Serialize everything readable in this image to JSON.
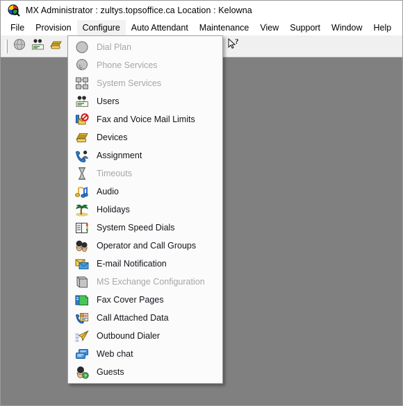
{
  "window": {
    "app_icon": "mx-globe-icon",
    "title": "MX Administrator : zultys.topsoffice.ca   Location : Kelowna"
  },
  "menubar": {
    "items": [
      {
        "label": "File",
        "name": "menu-file",
        "open": false
      },
      {
        "label": "Provision",
        "name": "menu-provision",
        "open": false
      },
      {
        "label": "Configure",
        "name": "menu-configure",
        "open": true
      },
      {
        "label": "Auto Attendant",
        "name": "menu-auto-attendant",
        "open": false
      },
      {
        "label": "Maintenance",
        "name": "menu-maintenance",
        "open": false
      },
      {
        "label": "View",
        "name": "menu-view",
        "open": false
      },
      {
        "label": "Support",
        "name": "menu-support",
        "open": false
      },
      {
        "label": "Window",
        "name": "menu-window",
        "open": false
      },
      {
        "label": "Help",
        "name": "menu-help",
        "open": false
      }
    ]
  },
  "toolbar": {
    "buttons": [
      {
        "name": "globe-icon",
        "glyph": "globe"
      },
      {
        "name": "users-icon",
        "glyph": "users"
      },
      {
        "name": "devices-phone-icon",
        "glyph": "phone-gold"
      },
      {
        "name": "dial-plan-icon",
        "glyph": "dialplan"
      },
      {
        "name": "assignment-icon",
        "glyph": "assignment"
      },
      {
        "name": "call-attached-data-icon",
        "glyph": "calldata"
      },
      {
        "name": "auto-attendant-icon",
        "glyph": "attendant"
      },
      {
        "name": "reports-icon",
        "glyph": "reports"
      },
      {
        "name": "books-icon",
        "glyph": "books"
      },
      {
        "name": "link-icon",
        "glyph": "link"
      },
      {
        "name": "tips-icon",
        "glyph": "bulb"
      },
      {
        "name": "context-help-icon",
        "glyph": "help-arrow"
      }
    ]
  },
  "dropdown": {
    "owner": "Configure",
    "items": [
      {
        "label": "Dial Plan",
        "name": "dial-plan",
        "icon": "dial-plan-icon",
        "disabled": true
      },
      {
        "label": "Phone Services",
        "name": "phone-services",
        "icon": "phone-services-icon",
        "disabled": true
      },
      {
        "label": "System Services",
        "name": "system-services",
        "icon": "system-services-icon",
        "disabled": true
      },
      {
        "label": "Users",
        "name": "users",
        "icon": "users-icon",
        "disabled": false
      },
      {
        "label": "Fax and Voice Mail Limits",
        "name": "fax-voicemail-limits",
        "icon": "fax-limits-icon",
        "disabled": false
      },
      {
        "label": "Devices",
        "name": "devices",
        "icon": "devices-icon",
        "disabled": false
      },
      {
        "label": "Assignment",
        "name": "assignment",
        "icon": "assignment-icon",
        "disabled": false
      },
      {
        "label": "Timeouts",
        "name": "timeouts",
        "icon": "timeouts-icon",
        "disabled": true
      },
      {
        "label": "Audio",
        "name": "audio",
        "icon": "audio-icon",
        "disabled": false
      },
      {
        "label": "Holidays",
        "name": "holidays",
        "icon": "holidays-icon",
        "disabled": false
      },
      {
        "label": "System Speed Dials",
        "name": "system-speed-dials",
        "icon": "speed-dials-icon",
        "disabled": false
      },
      {
        "label": "Operator and Call Groups",
        "name": "operator-call-groups",
        "icon": "operator-groups-icon",
        "disabled": false
      },
      {
        "label": "E-mail Notification",
        "name": "email-notification",
        "icon": "email-icon",
        "disabled": false
      },
      {
        "label": "MS Exchange Configuration",
        "name": "ms-exchange-configuration",
        "icon": "exchange-icon",
        "disabled": true
      },
      {
        "label": "Fax Cover Pages",
        "name": "fax-cover-pages",
        "icon": "fax-cover-icon",
        "disabled": false
      },
      {
        "label": "Call Attached Data",
        "name": "call-attached-data",
        "icon": "call-data-icon",
        "disabled": false
      },
      {
        "label": "Outbound Dialer",
        "name": "outbound-dialer",
        "icon": "outbound-dialer-icon",
        "disabled": false
      },
      {
        "label": "Web chat",
        "name": "web-chat",
        "icon": "web-chat-icon",
        "disabled": false
      },
      {
        "label": "Guests",
        "name": "guests",
        "icon": "guests-icon",
        "disabled": false
      }
    ]
  },
  "colors": {
    "titlebar_bg": "#ffffff",
    "toolbar_bg": "#f0f0f0",
    "client_bg": "#808080",
    "menu_bg": "#fbfbfb",
    "menu_open_bg": "#f2f2f2",
    "disabled_text": "#a6a6a6",
    "text": "#12131a"
  }
}
